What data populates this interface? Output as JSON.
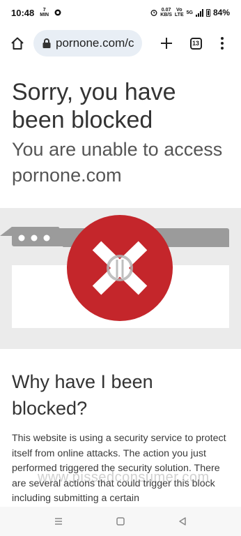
{
  "status_bar": {
    "time": "10:48",
    "notif_small": "7\nMIN",
    "net_speed": "0.07\nKB/S",
    "vo": "VoI\nLTE",
    "net_5g": "5G",
    "battery": "84%"
  },
  "browser": {
    "url": "pornone.com/c",
    "tab_count": "13"
  },
  "page": {
    "headline": "Sorry, you have been blocked",
    "subheadline": "You are unable to access pornone.com",
    "section_title": "Why have I been blocked?",
    "body": "This website is using a security service to protect itself from online attacks. The action you just performed triggered the security solution. There are several actions that could trigger this block including submitting a certain",
    "watermark": "www.pissedconsumer.com"
  },
  "colors": {
    "blocked_red": "#c4262b",
    "omnibox_bg": "#e8eef5",
    "illustration_bg": "#ebebeb"
  }
}
